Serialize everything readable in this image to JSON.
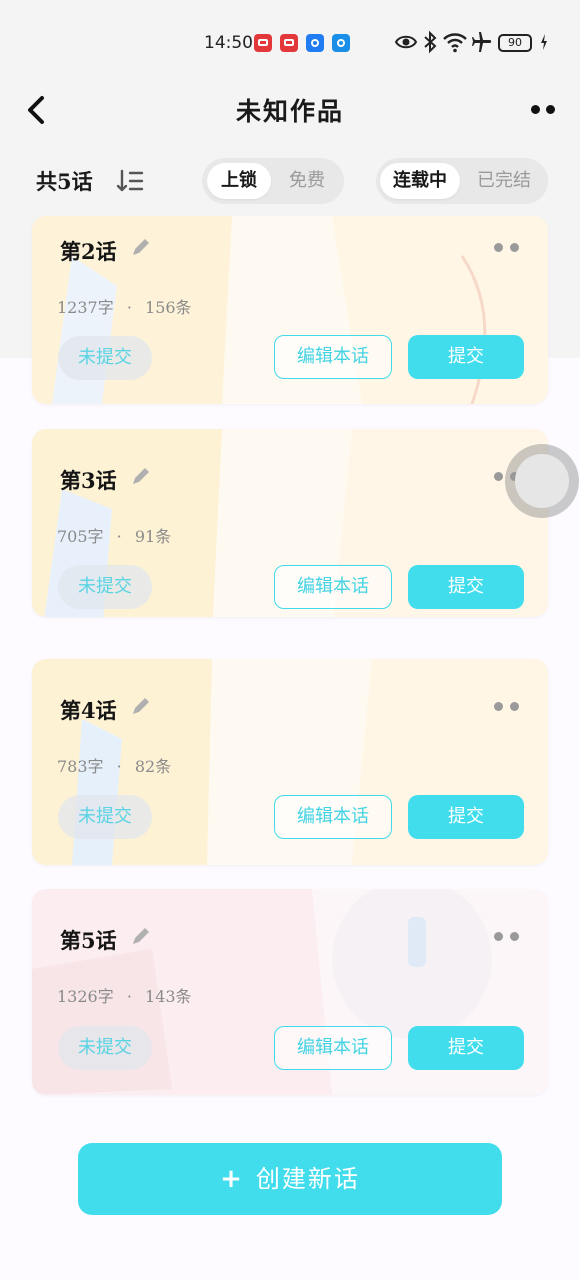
{
  "status_bar": {
    "time": "14:50",
    "battery": "90",
    "icons": [
      "app-red-icon",
      "app-red-icon",
      "app-blue-icon",
      "app-blue-icon",
      "eye-icon",
      "bluetooth-icon",
      "wifi-icon",
      "airplane-icon",
      "battery-icon",
      "charging-icon"
    ]
  },
  "nav": {
    "title": "未知作品",
    "back_icon": "chevron-left-icon",
    "more_icon": "more-icon"
  },
  "filter": {
    "count_label": "共5话",
    "sort_icon": "sort-icon",
    "lock_tabs": [
      "上锁",
      "免费"
    ],
    "status_tabs": [
      "连载中",
      "已完结"
    ]
  },
  "episodes": [
    {
      "title": "第2话",
      "words": "1237字",
      "separator": "·",
      "comments": "156条",
      "status": "未提交",
      "edit_label": "编辑本话",
      "submit_label": "提交"
    },
    {
      "title": "第3话",
      "words": "705字",
      "separator": "·",
      "comments": "91条",
      "status": "未提交",
      "edit_label": "编辑本话",
      "submit_label": "提交"
    },
    {
      "title": "第4话",
      "words": "783字",
      "separator": "·",
      "comments": "82条",
      "status": "未提交",
      "edit_label": "编辑本话",
      "submit_label": "提交"
    },
    {
      "title": "第5话",
      "words": "1326字",
      "separator": "·",
      "comments": "143条",
      "status": "未提交",
      "edit_label": "编辑本话",
      "submit_label": "提交"
    }
  ],
  "create_button": {
    "plus": "+",
    "label": "创建新话"
  },
  "colors": {
    "accent": "#42dded",
    "background": "#fdfbff",
    "header_bg": "#f4f4f4"
  }
}
